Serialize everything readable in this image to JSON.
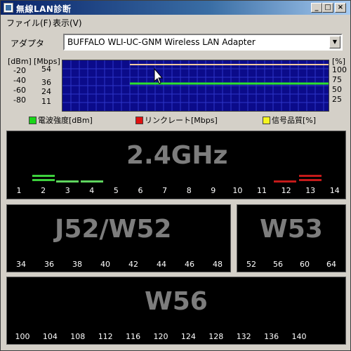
{
  "window": {
    "title": "無線LAN診断",
    "min_label": "_",
    "max_label": "□",
    "close_label": "×"
  },
  "menu": {
    "file": "ファイル(F)",
    "view": "表示(V)"
  },
  "adapter": {
    "label": "アダプタ",
    "value": "BUFFALO WLI-UC-GNM Wireless LAN Adapter",
    "arrow": "▼"
  },
  "axes": {
    "dbm_unit": "[dBm]",
    "mbps_unit": "[Mbps]",
    "pct_unit": "[%]",
    "dbm_ticks": [
      "-20",
      "-40",
      "-60",
      "-80"
    ],
    "mbps_ticks": [
      "54",
      "36",
      "24",
      "11"
    ],
    "pct_ticks": [
      "100",
      "75",
      "50",
      "25"
    ]
  },
  "legend": {
    "signal": {
      "label": "電波強度[dBm]",
      "color": "#19d619"
    },
    "rate": {
      "label": "リンクレート[Mbps]",
      "color": "#e01010"
    },
    "quality": {
      "label": "信号品質[%]",
      "color": "#f5f520"
    }
  },
  "graph_lines": {
    "rate_pct": 100,
    "signal_pct": 56
  },
  "band_24": {
    "title": "2.4GHz",
    "channels": [
      "1",
      "2",
      "3",
      "4",
      "5",
      "6",
      "7",
      "8",
      "9",
      "10",
      "11",
      "12",
      "13",
      "14"
    ]
  },
  "band_j52": {
    "title": "J52/W52",
    "channels": [
      "34",
      "36",
      "38",
      "40",
      "42",
      "44",
      "46",
      "48"
    ]
  },
  "band_w53": {
    "title": "W53",
    "channels": [
      "52",
      "56",
      "60",
      "64"
    ]
  },
  "band_w56": {
    "title": "W56",
    "channels": [
      "100",
      "104",
      "108",
      "112",
      "116",
      "120",
      "124",
      "128",
      "132",
      "136",
      "140"
    ]
  },
  "colors": {
    "green_bar": "#3dd13d",
    "light_green_bar": "#5fd55f",
    "red_bar": "#c41a1a"
  }
}
